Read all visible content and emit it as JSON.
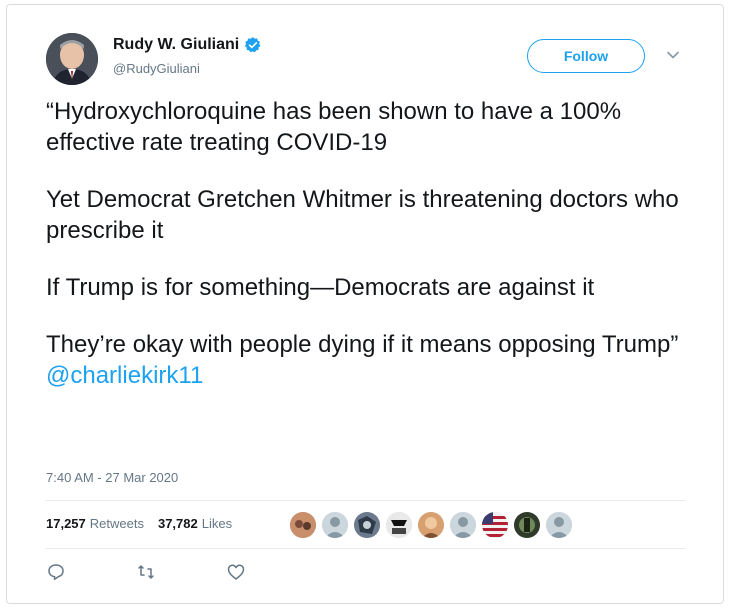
{
  "author": {
    "name": "Rudy W. Giuliani",
    "handle": "@RudyGiuliani",
    "verified": true
  },
  "follow_label": "Follow",
  "tweet": {
    "paragraphs": [
      "“Hydroxychloroquine has been shown to have a 100% effective rate treating COVID-19",
      "Yet Democrat Gretchen Whitmer is threatening doctors who prescribe it",
      "If Trump is for something—Democrats are against it"
    ],
    "last_paragraph_text": "They’re okay with people dying if it means opposing Trump” ",
    "mention": "@charliekirk11"
  },
  "timestamp": "7:40 AM - 27 Mar 2020",
  "stats": {
    "retweets_count": "17,257",
    "retweets_label": "Retweets",
    "likes_count": "37,782",
    "likes_label": "Likes"
  },
  "colors": {
    "accent": "#1da1f2",
    "secondary_text": "#657786",
    "primary_text": "#14171a"
  },
  "icons": {
    "verified": "verified-badge-icon",
    "caret": "chevron-down-icon",
    "reply": "reply-icon",
    "retweet": "retweet-icon",
    "like": "heart-icon"
  }
}
